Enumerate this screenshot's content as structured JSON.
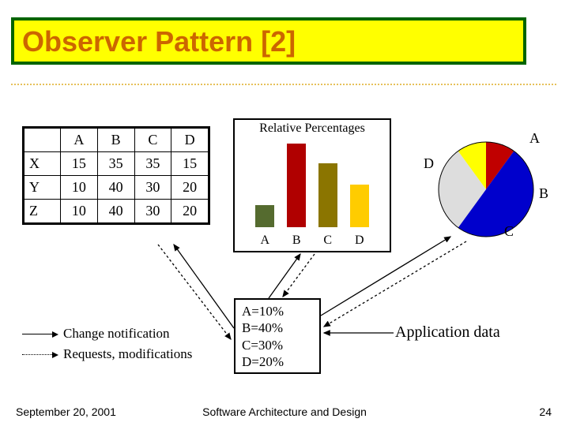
{
  "title": "Observer Pattern [2]",
  "table": {
    "cols": [
      "A",
      "B",
      "C",
      "D"
    ],
    "rows": [
      {
        "label": "X",
        "vals": [
          15,
          35,
          35,
          15
        ]
      },
      {
        "label": "Y",
        "vals": [
          10,
          40,
          30,
          20
        ]
      },
      {
        "label": "Z",
        "vals": [
          10,
          40,
          30,
          20
        ]
      }
    ]
  },
  "chart_data": [
    {
      "type": "bar",
      "title": "Relative Percentages",
      "categories": [
        "A",
        "B",
        "C",
        "D"
      ],
      "values": [
        10,
        40,
        30,
        20
      ],
      "colors": [
        "#556b2f",
        "#b00000",
        "#8b7500",
        "#ffcc00"
      ],
      "ylim": [
        0,
        45
      ],
      "xlabel": "",
      "ylabel": ""
    },
    {
      "type": "pie",
      "series": [
        {
          "name": "A",
          "value": 10,
          "color": "#c00000"
        },
        {
          "name": "B",
          "value": 40,
          "color": "#0000cc"
        },
        {
          "name": "C",
          "value": 30,
          "color": "#dddddd"
        },
        {
          "name": "D",
          "value": 20,
          "color": "#ffff00"
        }
      ]
    }
  ],
  "appdata": {
    "lines": [
      "A=10%",
      "B=40%",
      "C=30%",
      "D=20%"
    ],
    "label": "Application data"
  },
  "legend": {
    "solid": "Change notification",
    "dotted": "Requests, modifications"
  },
  "footer": {
    "date": "September 20, 2001",
    "center": "Software Architecture and Design",
    "page": "24"
  }
}
